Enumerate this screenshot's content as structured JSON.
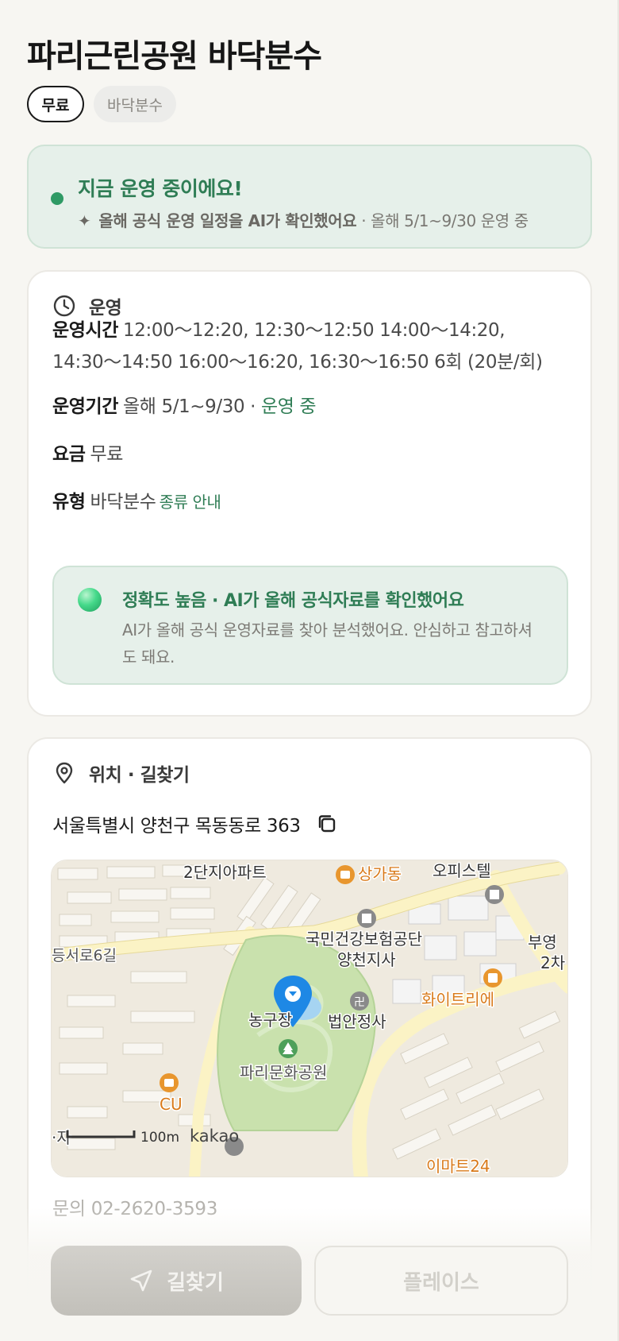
{
  "header": {
    "title": "파리근린공원 바닥분수",
    "chips": [
      "무료",
      "바닥분수"
    ]
  },
  "status": {
    "title": "지금 운영 중이에요!",
    "sparkle_icon": "sparkle-icon",
    "ai_note": "올해 공식 운영 일정을 AI가 확인했어요",
    "period_note": " · 올해 5/1~9/30 운영 중",
    "dot_color": "#2f9a65"
  },
  "operation": {
    "section_label": "운영",
    "hours_label": "운영시간",
    "hours_line1": "12:00～12:20, 12:30～12:50 14:00～14:20,",
    "hours_line2": "14:30～14:50 16:00～16:20, 16:30～16:50 6회 (20분/회)",
    "period_label": "운영기간",
    "period_value": "올해 5/1~9/30 · ",
    "period_status": "운영 중",
    "fee_label": "요금",
    "fee_value": "무료",
    "type_label": "유형",
    "type_value": "바닥분수",
    "type_link": "종류 안내",
    "accuracy_title": "정확도 높음 · AI가 올해 공식자료를 확인했어요",
    "accuracy_desc": "AI가 올해 공식 운영자료를 찾아 분석했어요. 안심하고 참고하셔도 돼요."
  },
  "location": {
    "section_label": "위치 · 길찾기",
    "address": "서울특별시 양천구 목동동로 363",
    "contact": "문의 02-2620-3593",
    "map_labels": {
      "apt": "2단지아파트",
      "shop": "상가동",
      "officetel": "오피스텔",
      "nhis_1": "국민건강보험공단",
      "nhis_2": "양천지사",
      "road": "등서로6길",
      "buyoung_1": "부영",
      "buyoung_2": "2차",
      "white": "화이트리에",
      "basketball": "농구장",
      "temple": "법안정사",
      "park": "파리문화공원",
      "cu": "CU",
      "scale": "100m",
      "brand": "kakao",
      "emart": "이마트24",
      "edge": "·자"
    }
  },
  "actions": {
    "directions": "길찾기",
    "places": "플레이스"
  }
}
